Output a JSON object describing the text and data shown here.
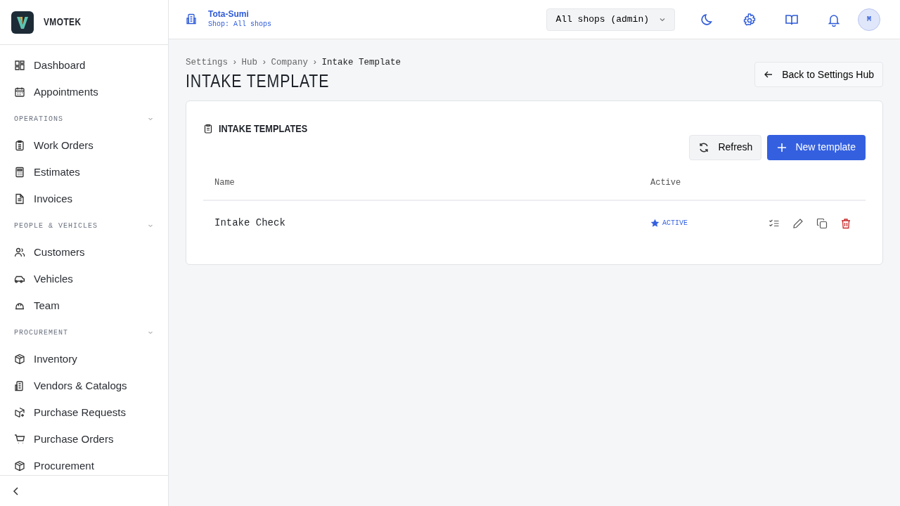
{
  "brand": {
    "name": "VMOTEK"
  },
  "sidebar": {
    "items": [
      {
        "kind": "item",
        "label": "Dashboard"
      },
      {
        "kind": "item",
        "label": "Appointments"
      },
      {
        "kind": "section",
        "label": "OPERATIONS",
        "expanded": true
      },
      {
        "kind": "item",
        "label": "Work Orders"
      },
      {
        "kind": "item",
        "label": "Estimates"
      },
      {
        "kind": "item",
        "label": "Invoices"
      },
      {
        "kind": "section",
        "label": "PEOPLE & VEHICLES",
        "expanded": true
      },
      {
        "kind": "item",
        "label": "Customers"
      },
      {
        "kind": "item",
        "label": "Vehicles"
      },
      {
        "kind": "item",
        "label": "Team"
      },
      {
        "kind": "section",
        "label": "PROCUREMENT",
        "expanded": true
      },
      {
        "kind": "item",
        "label": "Inventory"
      },
      {
        "kind": "item",
        "label": "Vendors & Catalogs"
      },
      {
        "kind": "item",
        "label": "Purchase Requests"
      },
      {
        "kind": "item",
        "label": "Purchase Orders"
      },
      {
        "kind": "item",
        "label": "Procurement"
      }
    ]
  },
  "header": {
    "company": "Tota-Sumi",
    "shop": "Shop: All shops",
    "shop_select": "All shops (admin)",
    "avatar": "M"
  },
  "breadcrumb": [
    {
      "label": "Settings"
    },
    {
      "separator": "›",
      "label": "Hub"
    },
    {
      "separator": "›",
      "label": "Company"
    },
    {
      "separator": "›",
      "label": "Intake Template"
    }
  ],
  "page_title": "INTAKE TEMPLATE",
  "back_button": "Back to Settings Hub",
  "card": {
    "title": "INTAKE TEMPLATES",
    "refresh_button": "Refresh",
    "new_button": "New template",
    "table": {
      "columns": [
        "Name",
        "Active"
      ],
      "rows": [
        {
          "name": "Intake Check",
          "active": true,
          "status": "ACTIVE"
        }
      ]
    }
  }
}
